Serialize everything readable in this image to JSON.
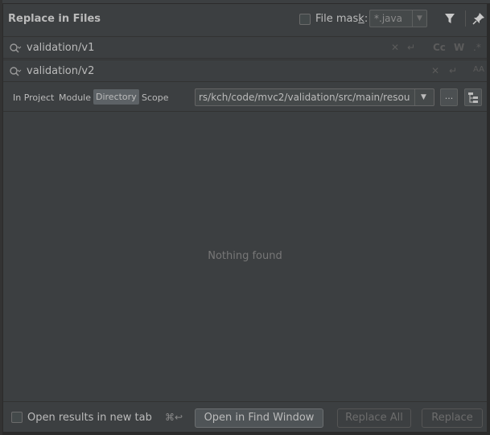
{
  "dialog": {
    "title": "Replace in Files",
    "file_mask": {
      "label": "File mas",
      "underline": "k",
      "suffix": ":",
      "value": "*.java",
      "checked": false
    }
  },
  "search": {
    "find_value": "validation/v1",
    "replace_value": "validation/v2",
    "find_options": [
      "Cc",
      "W"
    ],
    "replace_options": [
      "AA"
    ]
  },
  "scope": {
    "options": [
      "In Project",
      "Module",
      "Directory",
      "Scope"
    ],
    "selected": "Directory",
    "directory": "rs/kch/code/mvc2/validation/src/main/resou",
    "browse_label": "..."
  },
  "results": {
    "empty_text": "Nothing found"
  },
  "footer": {
    "open_in_new_tab": "Open results in new tab",
    "shortcut": "⌘↩",
    "open_in_find_window": "Open in Find Window",
    "replace_all": "Replace All",
    "replace": "Replace"
  },
  "colors": {
    "background": "#3c3f41",
    "selected_option": "#5d6266",
    "text": "#bbbbbb",
    "muted": "#777777"
  }
}
